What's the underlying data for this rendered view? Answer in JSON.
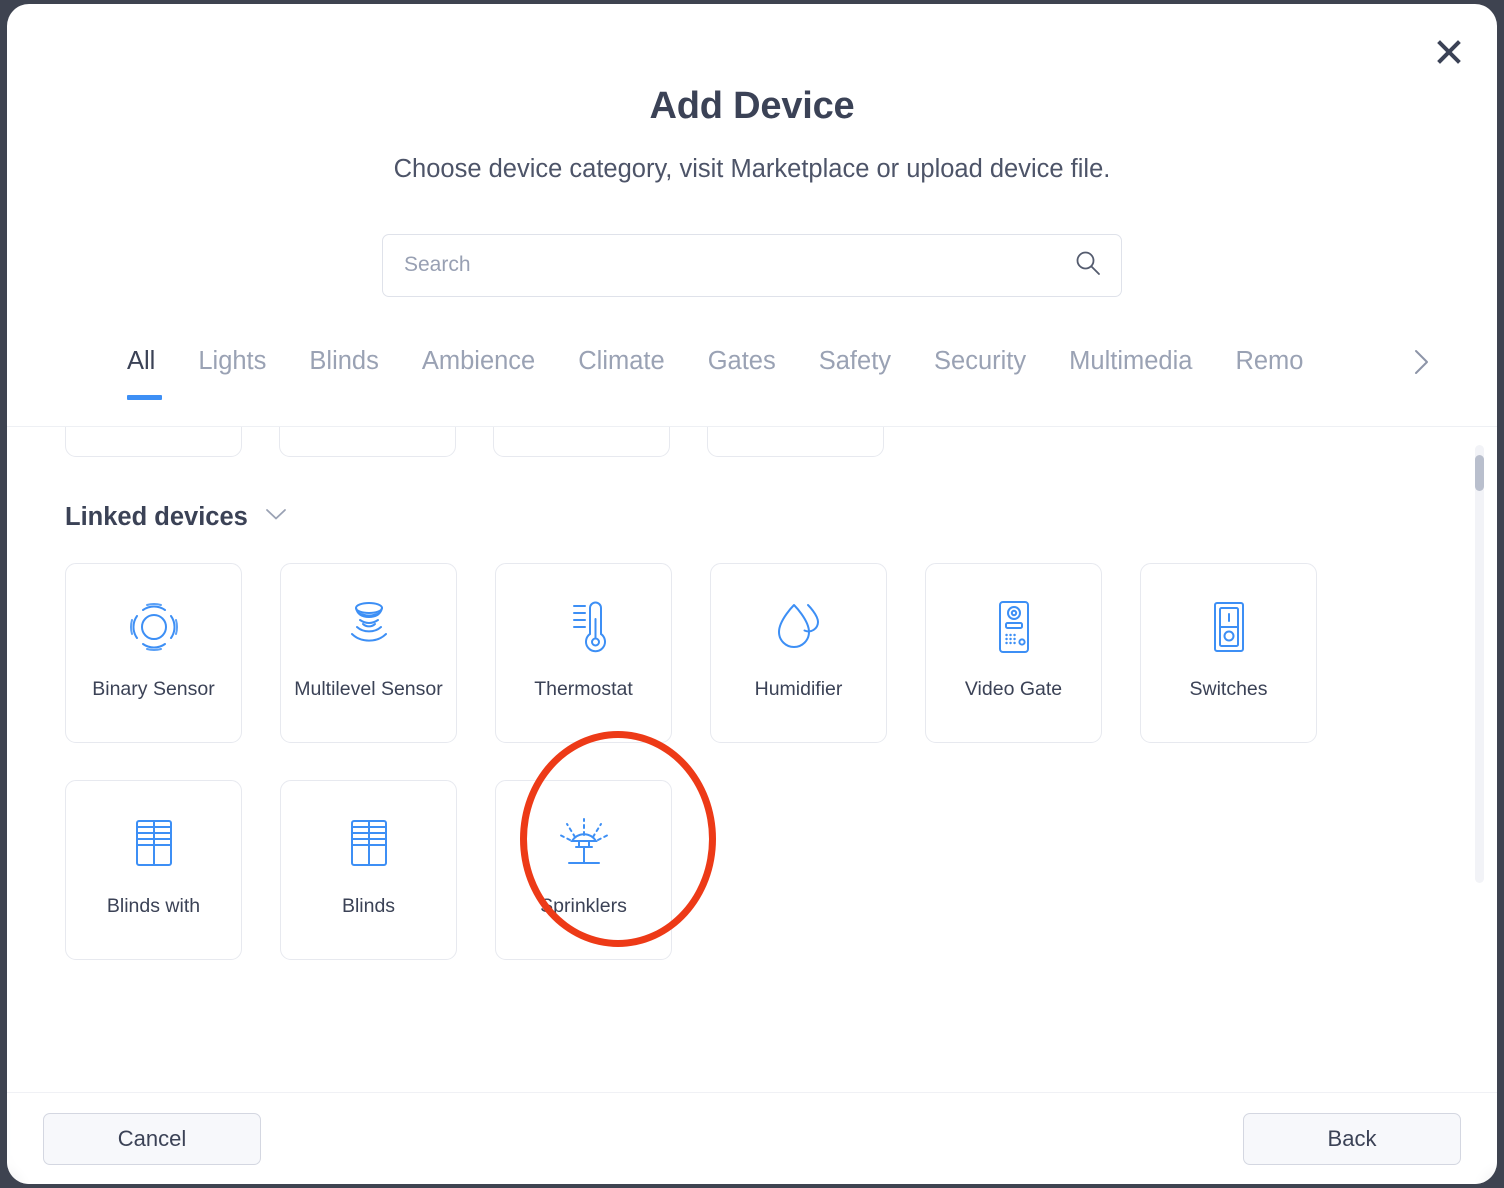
{
  "modal": {
    "title": "Add Device",
    "subtitle": "Choose device category, visit Marketplace or upload device file.",
    "close_label": "close-icon"
  },
  "search": {
    "placeholder": "Search",
    "value": "",
    "icon": "search-icon"
  },
  "tabs": {
    "active": "All",
    "next_icon": "chevron-right-icon",
    "items": [
      {
        "label": "All",
        "active": true
      },
      {
        "label": "Lights",
        "active": false
      },
      {
        "label": "Blinds",
        "active": false
      },
      {
        "label": "Ambience",
        "active": false
      },
      {
        "label": "Climate",
        "active": false
      },
      {
        "label": "Gates",
        "active": false
      },
      {
        "label": "Safety",
        "active": false
      },
      {
        "label": "Security",
        "active": false
      },
      {
        "label": "Multimedia",
        "active": false
      },
      {
        "label": "Remo",
        "active": false
      }
    ]
  },
  "section": {
    "title": "Linked devices",
    "collapse_icon": "chevron-down-icon",
    "expanded": true
  },
  "devices": [
    {
      "label": "Binary Sensor",
      "icon": "binary-sensor-icon"
    },
    {
      "label": "Multilevel Sensor",
      "icon": "multilevel-sensor-icon"
    },
    {
      "label": "Thermostat",
      "icon": "thermostat-icon",
      "highlighted": true
    },
    {
      "label": "Humidifier",
      "icon": "humidifier-icon"
    },
    {
      "label": "Video Gate",
      "icon": "video-gate-icon"
    },
    {
      "label": "Switches",
      "icon": "switches-icon"
    },
    {
      "label": "Blinds with",
      "icon": "blinds-with-icon"
    },
    {
      "label": "Blinds",
      "icon": "blinds-icon"
    },
    {
      "label": "Sprinklers",
      "icon": "sprinkler-icon"
    }
  ],
  "footer": {
    "cancel_label": "Cancel",
    "back_label": "Back"
  },
  "scrollbar": {
    "position": "top"
  },
  "colors": {
    "accent": "#3d8ff5",
    "text": "#3b4256",
    "muted": "#9aa2b4",
    "annotation": "#ed3a17",
    "backdrop": "#3e4350"
  }
}
